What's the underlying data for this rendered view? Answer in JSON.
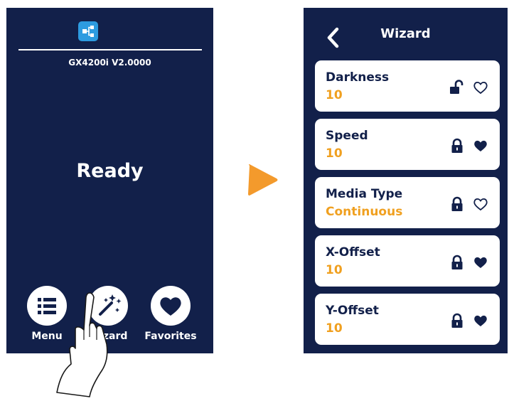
{
  "left_screen": {
    "model": "GX4200i V2.0000",
    "status": "Ready",
    "buttons": [
      {
        "label": "Menu",
        "icon": "list-icon"
      },
      {
        "label": "Wizard",
        "icon": "magic-wand-icon"
      },
      {
        "label": "Favorites",
        "icon": "heart-icon"
      }
    ]
  },
  "right_screen": {
    "title": "Wizard",
    "items": [
      {
        "title": "Darkness",
        "value": "10",
        "locked": false,
        "favorite": false
      },
      {
        "title": "Speed",
        "value": "10",
        "locked": true,
        "favorite": true
      },
      {
        "title": "Media Type",
        "value": "Continuous",
        "locked": true,
        "favorite": false
      },
      {
        "title": "X-Offset",
        "value": "10",
        "locked": true,
        "favorite": true
      },
      {
        "title": "Y-Offset",
        "value": "10",
        "locked": true,
        "favorite": true
      }
    ]
  },
  "colors": {
    "screen_bg": "#12204a",
    "accent_orange": "#f0a020",
    "network_blue": "#2d9be0",
    "arrow_orange": "#f39a2c"
  }
}
